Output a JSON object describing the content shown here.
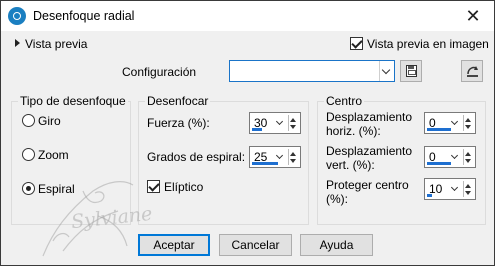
{
  "window": {
    "title": "Desenfoque radial"
  },
  "preview": {
    "toggle_label": "Vista previa",
    "checkbox_label": "Vista previa en imagen",
    "checked": true
  },
  "config": {
    "label": "Configuración",
    "value": ""
  },
  "blur_type": {
    "label": "Tipo de desenfoque",
    "options": [
      {
        "label": "Giro",
        "selected": false
      },
      {
        "label": "Zoom",
        "selected": false
      },
      {
        "label": "Espiral",
        "selected": true
      }
    ]
  },
  "blur": {
    "label": "Desenfocar",
    "strength_label": "Fuerza (%):",
    "strength_value": "30",
    "spiral_label": "Grados de espiral:",
    "spiral_value": "25",
    "elliptic_label": "Elíptico",
    "elliptic_checked": true
  },
  "center": {
    "label": "Centro",
    "h_offset_label": [
      "Desplazamiento",
      "horiz. (%):"
    ],
    "h_offset_value": "0",
    "v_offset_label": [
      "Desplazamiento",
      "vert. (%):"
    ],
    "v_offset_value": "0",
    "protect_label": [
      "Proteger centro",
      "(%):"
    ],
    "protect_value": "10"
  },
  "watermark": {
    "text": "Sylviane"
  },
  "buttons": {
    "ok": "Aceptar",
    "cancel": "Cancelar",
    "help": "Ayuda"
  }
}
